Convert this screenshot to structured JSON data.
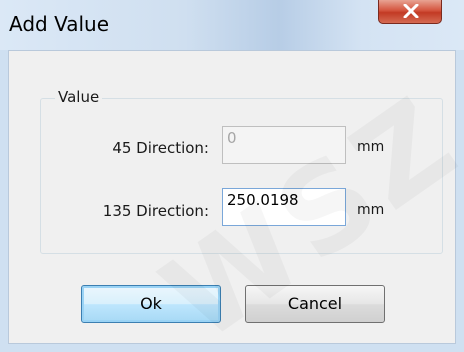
{
  "window": {
    "title": "Add Value"
  },
  "group": {
    "label": "Value"
  },
  "fields": [
    {
      "label": "45 Direction:",
      "value": "0",
      "unit": "mm",
      "enabled": false
    },
    {
      "label": "135 Direction:",
      "value": "250.0198",
      "unit": "mm",
      "enabled": true
    }
  ],
  "buttons": {
    "ok_label": "Ok",
    "cancel_label": "Cancel"
  },
  "watermark": {
    "text": "WSZ"
  },
  "colors": {
    "titlebar": "#cfe0f1",
    "close_button": "#c94b35",
    "default_button_border": "#3c7fb1"
  }
}
